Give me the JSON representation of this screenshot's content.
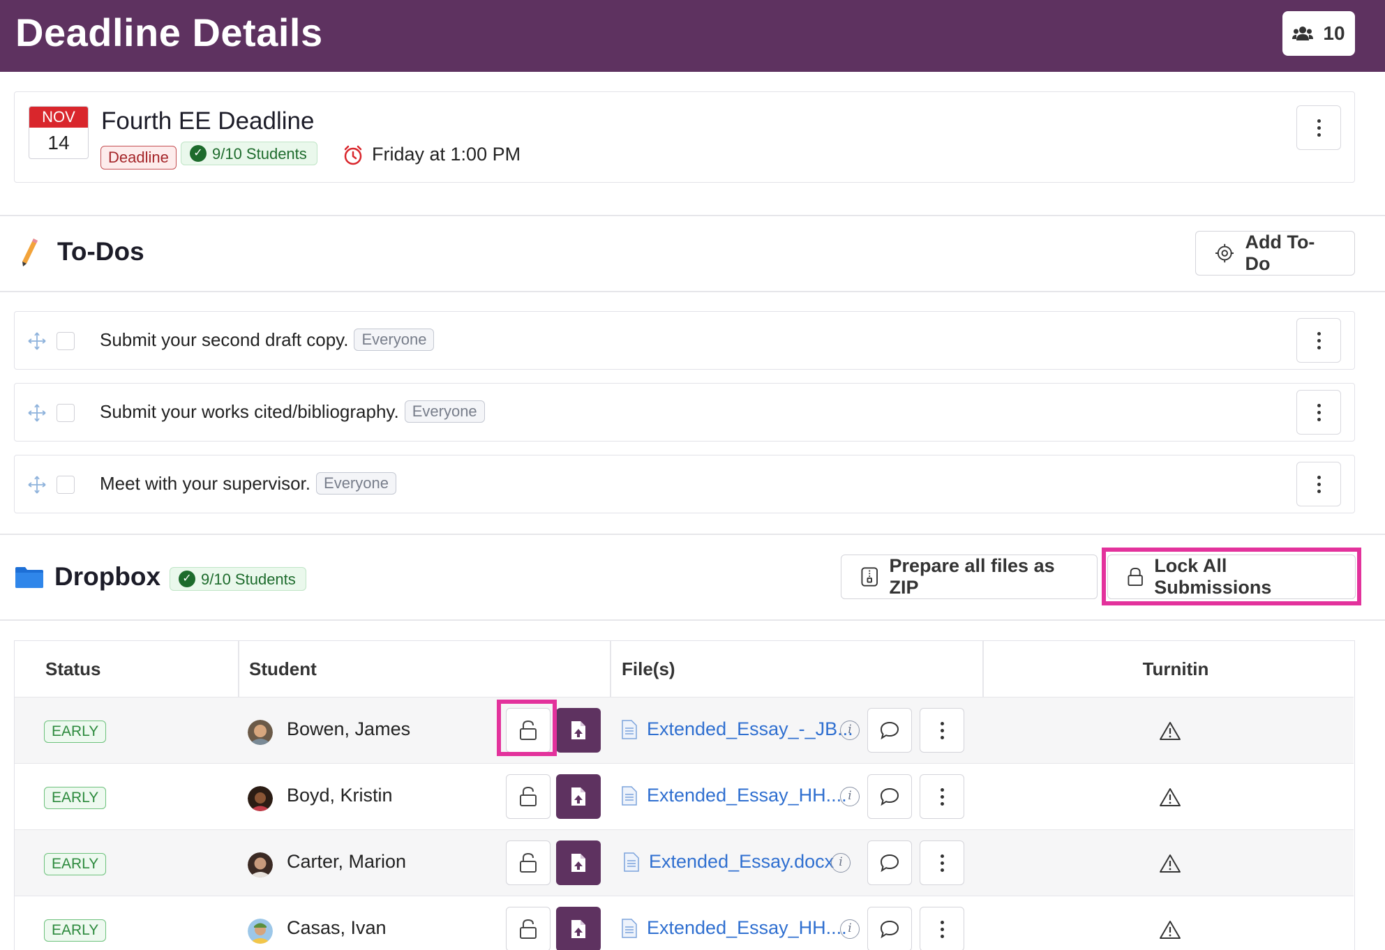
{
  "header": {
    "title": "Deadline Details",
    "member_count": "10"
  },
  "deadline": {
    "month": "NOV",
    "day": "14",
    "title": "Fourth EE Deadline",
    "type_tag": "Deadline",
    "students_tag": "9/10 Students",
    "due_text": "Friday at 1:00 PM"
  },
  "todos": {
    "title": "To-Dos",
    "add_label": "Add To-Do",
    "items": [
      {
        "text": "Submit your second draft copy.",
        "audience": "Everyone"
      },
      {
        "text": "Submit your works cited/bibliography.",
        "audience": "Everyone"
      },
      {
        "text": "Meet with your supervisor.",
        "audience": "Everyone"
      }
    ]
  },
  "dropbox": {
    "title": "Dropbox",
    "students_tag": "9/10 Students",
    "zip_label": "Prepare all files as ZIP",
    "lock_all_label": "Lock All Submissions",
    "columns": [
      "Status",
      "Student",
      "File(s)",
      "Turnitin"
    ],
    "rows": [
      {
        "status": "EARLY",
        "student": "Bowen, James",
        "file": "Extended_Essay_-_JB..."
      },
      {
        "status": "EARLY",
        "student": "Boyd, Kristin",
        "file": "Extended_Essay_HH...."
      },
      {
        "status": "EARLY",
        "student": "Carter, Marion",
        "file": "Extended_Essay.docx"
      },
      {
        "status": "EARLY",
        "student": "Casas, Ivan",
        "file": "Extended_Essay_HH...."
      }
    ]
  },
  "colors": {
    "header_bg": "#5e3260",
    "highlight": "#e3329c",
    "link": "#2f6fd0",
    "success": "#1d6b2c",
    "deadline_red": "#d9262c"
  },
  "icons": [
    "users-icon",
    "clock-alarm-icon",
    "pencil-icon",
    "target-icon",
    "move-icon",
    "folder-icon",
    "zip-file-icon",
    "lock-icon",
    "unlock-icon",
    "upload-file-icon",
    "document-icon",
    "info-icon",
    "comment-icon",
    "more-vertical-icon",
    "warning-icon"
  ]
}
